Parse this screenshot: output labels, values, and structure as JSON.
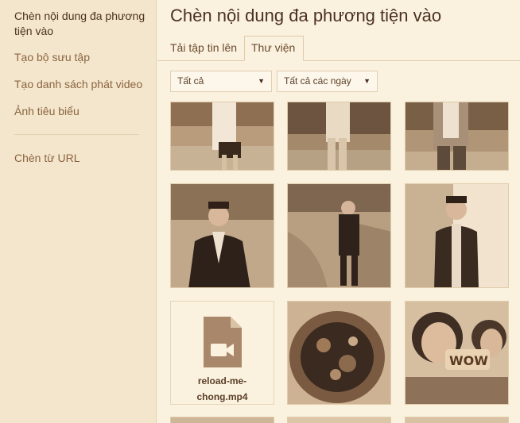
{
  "sidebar": {
    "items": [
      {
        "label": "Chèn nội dung đa phương tiện vào",
        "active": true
      },
      {
        "label": "Tạo bộ sưu tập"
      },
      {
        "label": "Tạo danh sách phát video"
      },
      {
        "label": "Ảnh tiêu biểu"
      },
      {
        "label": "Chèn từ URL"
      }
    ]
  },
  "main": {
    "title": "Chèn nội dung đa phương tiện vào",
    "tabs": [
      {
        "label": "Tải tập tin lên"
      },
      {
        "label": "Thư viện",
        "active": true
      }
    ],
    "filters": {
      "type": {
        "selected": "Tất cả"
      },
      "date": {
        "selected": "Tất cả các ngày"
      }
    },
    "file_item": {
      "name_line1": "reload-me-",
      "name_line2": "chong.mp4",
      "icon": "video-file-icon"
    }
  },
  "colors": {
    "background": "#fbf1df",
    "sidebar": "#f4e6cc",
    "text": "#5a3f26",
    "file_icon": "#a9876a"
  }
}
